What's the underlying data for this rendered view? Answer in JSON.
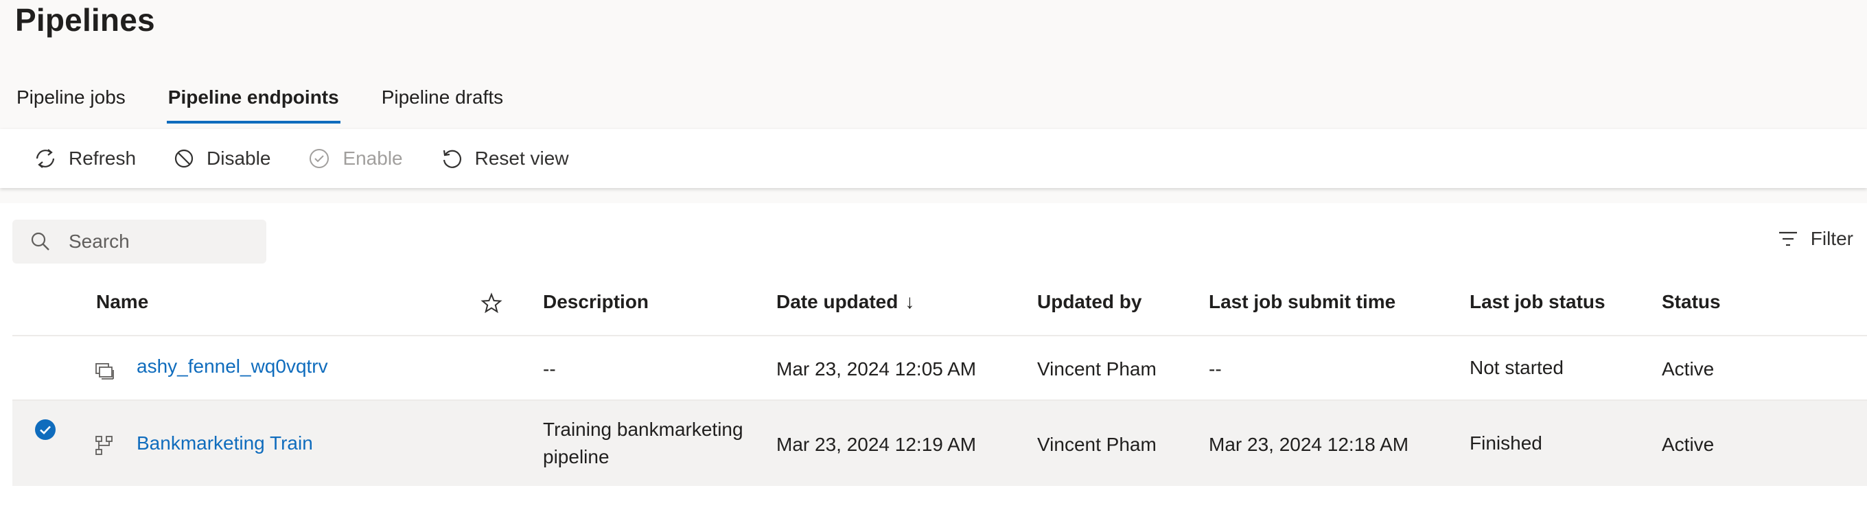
{
  "page": {
    "title": "Pipelines"
  },
  "tabs": [
    {
      "label": "Pipeline jobs",
      "active": false
    },
    {
      "label": "Pipeline endpoints",
      "active": true
    },
    {
      "label": "Pipeline drafts",
      "active": false
    }
  ],
  "toolbar": {
    "refresh_label": "Refresh",
    "disable_label": "Disable",
    "enable_label": "Enable",
    "reset_label": "Reset view"
  },
  "search": {
    "placeholder": "Search"
  },
  "filter": {
    "label": "Filter"
  },
  "table": {
    "columns": {
      "name": "Name",
      "description": "Description",
      "date_updated": "Date updated",
      "sort_indicator": "↓",
      "updated_by": "Updated by",
      "last_job_submit_time": "Last job submit time",
      "last_job_status": "Last job status",
      "status": "Status"
    },
    "rows": [
      {
        "selected": false,
        "icon": "pipeline-run-icon",
        "name": "ashy_fennel_wq0vqtrv",
        "description_line1": "--",
        "description_line2": "",
        "date_updated": "Mar 23, 2024 12:05 AM",
        "updated_by": "Vincent Pham",
        "last_job_submit_time": "--",
        "last_job_status": "Not started",
        "status": "Active"
      },
      {
        "selected": true,
        "icon": "pipeline-graph-icon",
        "name": "Bankmarketing Train",
        "description_line1": "Training bankmarketing",
        "description_line2": "pipeline",
        "date_updated": "Mar 23, 2024 12:19 AM",
        "updated_by": "Vincent Pham",
        "last_job_submit_time": "Mar 23, 2024 12:18 AM",
        "last_job_status": "Finished",
        "status": "Active"
      }
    ]
  },
  "colors": {
    "accent": "#0f6cbd",
    "selected_row": "#f3f2f1",
    "disabled": "#a19f9d"
  }
}
